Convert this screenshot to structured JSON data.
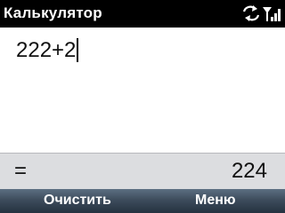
{
  "titlebar": {
    "title": "Калькулятор",
    "icons": [
      "sync-icon",
      "signal-strength-icon"
    ]
  },
  "calculator": {
    "expression": "222+2",
    "equals_sign": "=",
    "result": "224"
  },
  "softkeys": {
    "left_label": "Очистить",
    "right_label": "Меню"
  },
  "colors": {
    "titlebar_bg": "#000000",
    "result_bar_bg": "#dcdde0",
    "softkey_bar_bg": "#3d4c5c"
  }
}
